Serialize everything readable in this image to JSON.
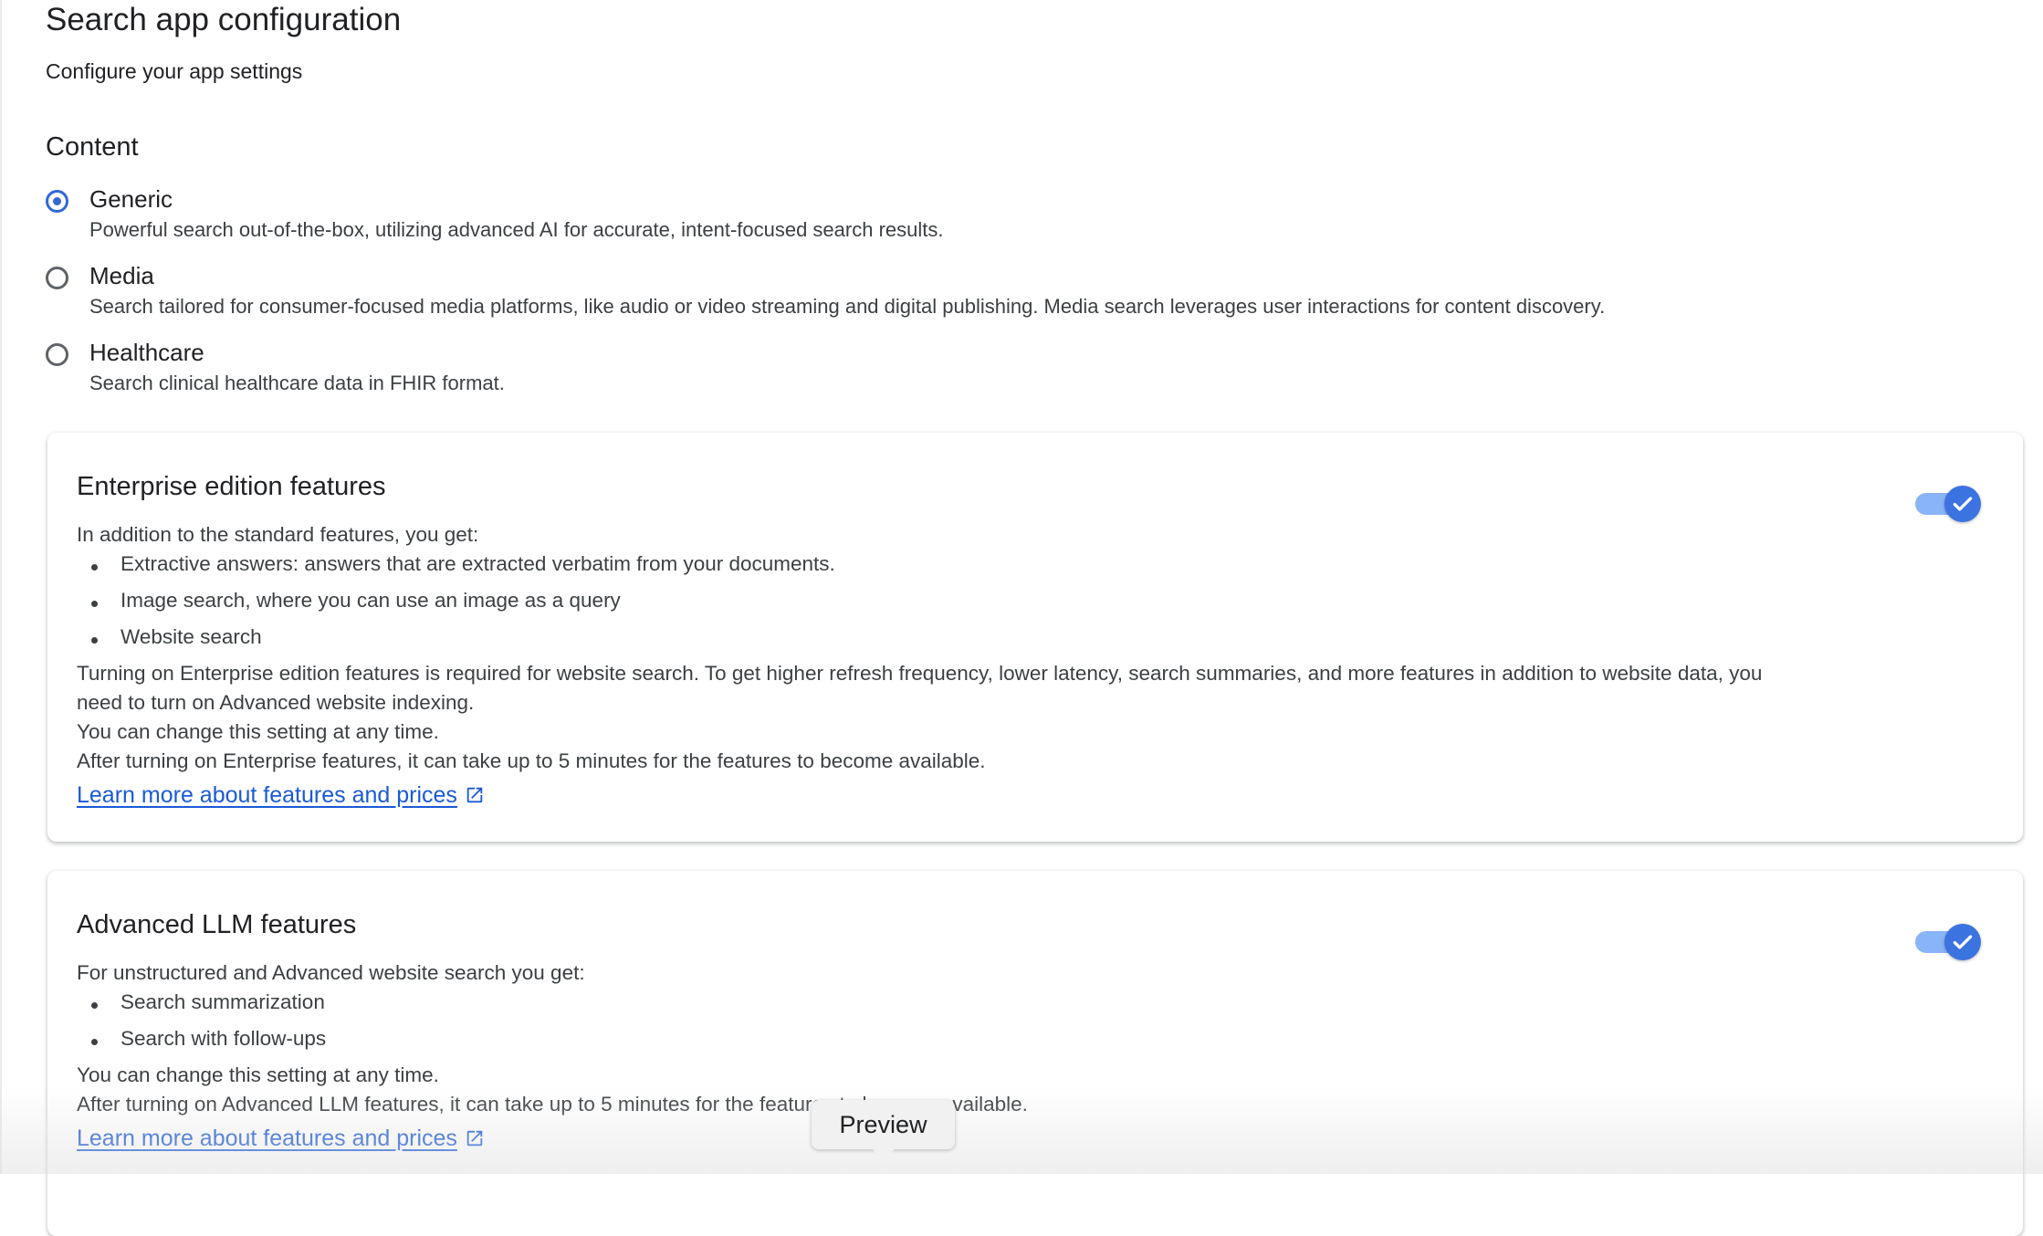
{
  "page": {
    "title": "Search app configuration",
    "subtitle": "Configure your app settings"
  },
  "content_section": {
    "title": "Content",
    "options": [
      {
        "label": "Generic",
        "description": "Powerful search out-of-the-box, utilizing advanced AI for accurate, intent-focused search results.",
        "selected": true
      },
      {
        "label": "Media",
        "description": "Search tailored for consumer-focused media platforms, like audio or video streaming and digital publishing. Media search leverages user interactions for content discovery.",
        "selected": false
      },
      {
        "label": "Healthcare",
        "description": "Search clinical healthcare data in FHIR format.",
        "selected": false
      }
    ]
  },
  "enterprise_card": {
    "title": "Enterprise edition features",
    "intro": "In addition to the standard features, you get:",
    "bullets": [
      "Extractive answers: answers that are extracted verbatim from your documents.",
      "Image search, where you can use an image as a query",
      "Website search"
    ],
    "para1_line1": "Turning on Enterprise edition features is required for website search. To get higher refresh frequency, lower latency, search summaries, and more features in addition to website data, you",
    "para1_line2": "need to turn on Advanced website indexing.",
    "para2": "You can change this setting at any time.",
    "para3": "After turning on Enterprise features, it can take up to 5 minutes for the features to become available.",
    "link": "Learn more about features and prices",
    "enabled": true
  },
  "llm_card": {
    "title": "Advanced LLM features",
    "intro": "For unstructured and Advanced website search you get:",
    "bullets": [
      "Search summarization",
      "Search with follow-ups"
    ],
    "para1": "You can change this setting at any time.",
    "para2": "After turning on Advanced LLM features, it can take up to 5 minutes for the features to become available.",
    "link": "Learn more about features and prices",
    "enabled": true
  },
  "tooltip": {
    "label": "Preview"
  },
  "colors": {
    "accent": "#3367d6",
    "link": "#1a5ad6",
    "toggle_track": "#8ab4f8",
    "toggle_thumb": "#3b73e0"
  },
  "icons": {
    "external_link": "external-link-icon",
    "check": "check-icon"
  }
}
